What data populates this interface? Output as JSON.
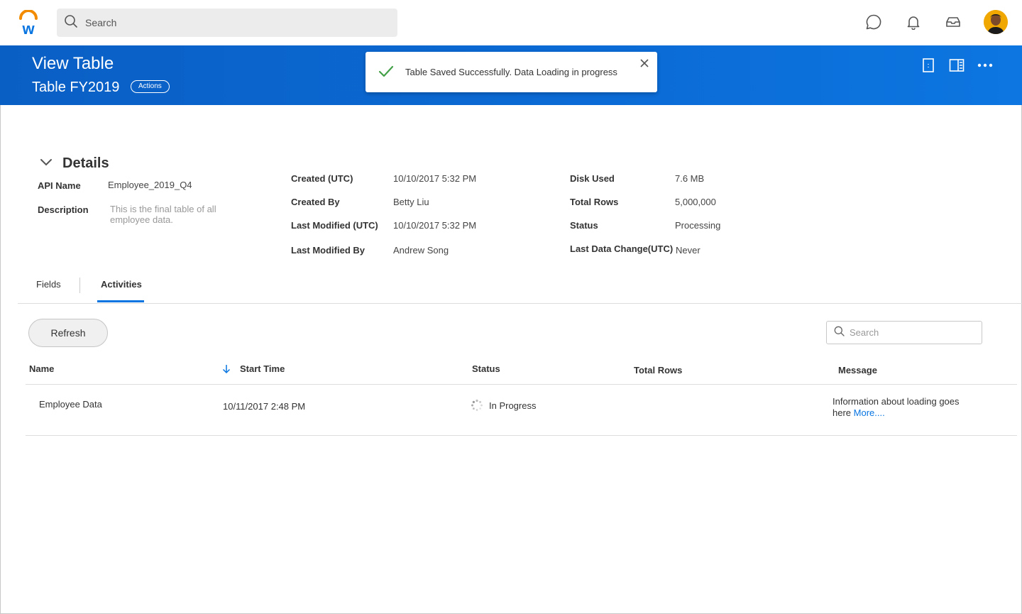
{
  "app": {
    "search_placeholder": "Search",
    "colors": {
      "brand_blue": "#0875e1",
      "brand_orange": "#f38b00",
      "success_green": "#43a047"
    }
  },
  "header": {
    "title": "View Table",
    "subtitle": "Table FY2019",
    "actions_label": "Actions"
  },
  "toast": {
    "message": "Table Saved Successfully. Data Loading in progress"
  },
  "details": {
    "heading": "Details",
    "col1": [
      {
        "label": "API Name",
        "value": "Employee_2019_Q4"
      },
      {
        "label": "Description",
        "value": "This is the final table of all employee data."
      }
    ],
    "col2": [
      {
        "label": "Created (UTC)",
        "value": "10/10/2017 5:32 PM"
      },
      {
        "label": "Created By",
        "value": "Betty Liu"
      },
      {
        "label": "Last Modified (UTC)",
        "value": "10/10/2017 5:32 PM"
      },
      {
        "label": "Last Modified By",
        "value": "Andrew Song"
      }
    ],
    "col3": [
      {
        "label": "Disk Used",
        "value": "7.6 MB"
      },
      {
        "label": "Total Rows",
        "value": "5,000,000"
      },
      {
        "label": "Status",
        "value": "Processing"
      },
      {
        "label": "Last Data Change(UTC)",
        "value": "Never"
      }
    ]
  },
  "tabs": [
    {
      "label": "Fields"
    },
    {
      "label": "Activities"
    }
  ],
  "activities": {
    "refresh_label": "Refresh",
    "search_placeholder": "Search",
    "columns": [
      "Name",
      "Start Time",
      "Status",
      "Total Rows",
      "Message"
    ],
    "rows": [
      {
        "name": "Employee Data",
        "start_time": "10/11/2017 2:48 PM",
        "status": "In Progress",
        "total_rows": "",
        "message": "Information  about loading goes here",
        "more_link": "More...."
      }
    ]
  }
}
